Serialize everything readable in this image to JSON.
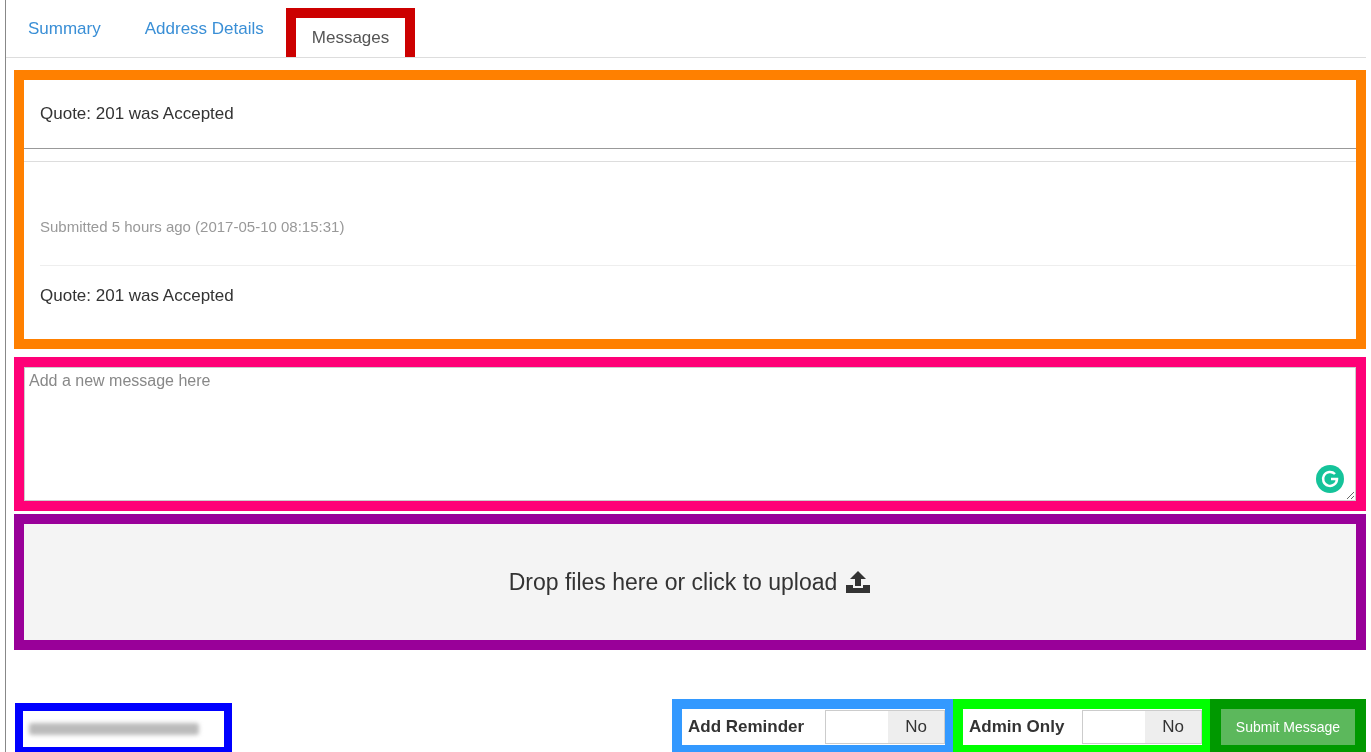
{
  "tabs": [
    {
      "label": "Summary",
      "selected": false
    },
    {
      "label": "Address Details",
      "selected": false
    },
    {
      "label": "Messages",
      "selected": true
    }
  ],
  "messages": [
    {
      "kind": "header",
      "text": "Quote: 201 was Accepted"
    },
    {
      "kind": "meta",
      "text": "Submitted 5 hours ago (2017-05-10 08:15:31)"
    },
    {
      "kind": "body",
      "text": "Quote: 201 was Accepted"
    }
  ],
  "composer": {
    "placeholder": "Add a new message here"
  },
  "dropzone": {
    "text": "Drop files here or click to upload"
  },
  "toggles": [
    {
      "label": "Add Reminder",
      "value": "No",
      "on": false
    },
    {
      "label": "Admin Only",
      "value": "No",
      "on": false
    }
  ],
  "submit": {
    "label": "Submit Message"
  }
}
